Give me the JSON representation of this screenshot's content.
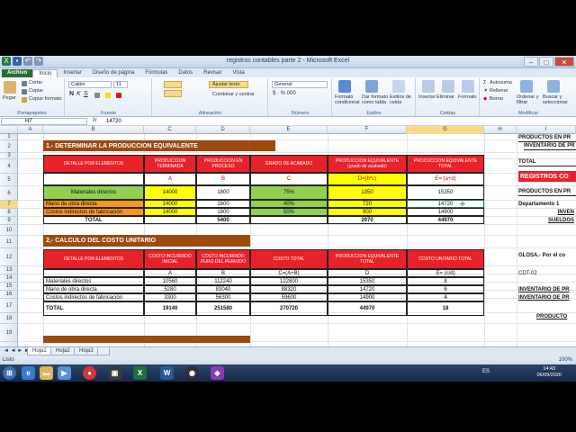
{
  "window": {
    "title": "registros contables parte 2 - Microsoft Excel"
  },
  "tabs": [
    "Archivo",
    "Inicio",
    "Insertar",
    "Diseño de página",
    "Fórmulas",
    "Datos",
    "Revisar",
    "Vista"
  ],
  "ribbon": {
    "clipboard": {
      "paste": "Pegar",
      "cut": "Cortar",
      "copy": "Copiar",
      "format_painter": "Copiar formato",
      "label": "Portapapeles"
    },
    "font": {
      "name": "Calibri",
      "size": "11",
      "label": "Fuente"
    },
    "alignment": {
      "wrap": "Ajustar texto",
      "merge": "Combinar y centrar",
      "label": "Alineación"
    },
    "number": {
      "format": "General",
      "label": "Número"
    },
    "styles": {
      "cond": "Formato condicional",
      "table": "Dar formato como tabla",
      "cell": "Estilos de celda",
      "label": "Estilos"
    },
    "cells": {
      "insert": "Insertar",
      "delete": "Eliminar",
      "format": "Formato",
      "label": "Celdas"
    },
    "editing": {
      "autosum": "Autosuma",
      "fill": "Rellenar",
      "clear": "Borrar",
      "sort": "Ordenar y filtrar",
      "find": "Buscar y seleccionar",
      "label": "Modificar"
    }
  },
  "formula_bar": {
    "cell": "H7",
    "fx": "fx",
    "value": "14720"
  },
  "columns": [
    "A",
    "B",
    "C",
    "D",
    "E",
    "F",
    "G",
    "H",
    "I"
  ],
  "rows": [
    "1",
    "2",
    "3",
    "4",
    "5",
    "6",
    "7",
    "8",
    "9",
    "10",
    "11",
    "12",
    "13",
    "14",
    "15",
    "16",
    "17",
    "18",
    "19"
  ],
  "section1": "1.- DETERMINAR LA PRODUCCION EQUIVALENTE",
  "table1": {
    "headers": [
      "DETALLE POR ELEMENTOS",
      "PRODUCCION TERMINADA",
      "PRODUCCION EN PROCESO",
      "GRADO DE ACABADO",
      "PRODUCCION EQUIVALENTE (grado de acabado)",
      "PROCUCCION EQUIVALENTE TOTAL"
    ],
    "letters": [
      "A",
      "B",
      "C",
      "D=(b*c)",
      "E= (a+d)"
    ],
    "rows": [
      [
        "Materiales directos",
        "14000",
        "1800",
        "75%",
        "1350",
        "15350"
      ],
      [
        "Mano de obra directa",
        "14000",
        "1800",
        "40%",
        "720",
        "14720"
      ],
      [
        "Costos indirectos de fabricación",
        "14000",
        "1800",
        "50%",
        "900",
        "14900"
      ]
    ],
    "total": [
      "TOTAL",
      "5400",
      "2970",
      "44970"
    ]
  },
  "section2": "2,- CALCULO DEL COSTO UNITARIO",
  "table2": {
    "headers": [
      "DETALLE POR ELEMENTOS",
      "COSTO INCURRIDO INICIAL",
      "COSTO INCURRIDO PURO DEL PERIODO",
      "COSTO TOTAL",
      "PRODUCCION EQUIVALENTE TOTAL",
      "COSTO UNITARIO TOTAL"
    ],
    "letters": [
      "A",
      "B",
      "C=(A+B)",
      "D",
      "E= (c/d)"
    ],
    "rows": [
      [
        "Materiales directos",
        "10560",
        "112240",
        "122800",
        "15350",
        "8"
      ],
      [
        "Mano de obra directa",
        "5280",
        "83040",
        "88320",
        "14720",
        "6"
      ],
      [
        "Costos indirectos de fabricación",
        "3300",
        "56300",
        "59600",
        "14900",
        "4"
      ]
    ],
    "total": [
      "TOTAL",
      "19140",
      "251580",
      "270720",
      "44970",
      "18"
    ]
  },
  "right_panel": [
    "PRODUCTOS EN PR",
    "INVENTARIO DE PR",
    "TOTAL",
    "REGISTROS CO",
    "PRODUCTOS EN PR",
    "Departamento 1",
    "INVEN",
    "SUELDOS",
    "GLOSA.- Por el co",
    "CDT-02",
    "INVENTARIO DE PR",
    "INVENTARIO DE PR",
    "PRODUCTO"
  ],
  "sheets": [
    "Hoja1",
    "Hoja2",
    "Hoja3"
  ],
  "status": "Listo",
  "zoom": "100%",
  "taskbar": {
    "lang": "ES",
    "time": "14:43",
    "date": "06/09/2020"
  },
  "colors": {
    "red": "#e8222a",
    "brown": "#9d4a0f",
    "yellow": "#ffff00",
    "green": "#92d050",
    "orange": "#f79621"
  }
}
